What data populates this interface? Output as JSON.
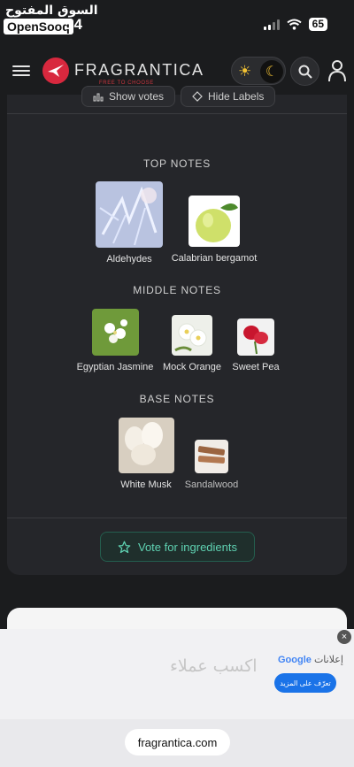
{
  "status_bar": {
    "watermark_arabic": "السوق المفتوح",
    "watermark_latin": "OpenSooq",
    "time": "14",
    "battery": "65"
  },
  "header": {
    "brand": "FRAGRANTICA",
    "tagline": "FREE TO CHOOSE"
  },
  "controls": {
    "show_votes": "Show votes",
    "hide_labels": "Hide Labels"
  },
  "sections": [
    {
      "title": "TOP NOTES",
      "notes": [
        "Aldehydes",
        "Calabrian bergamot"
      ]
    },
    {
      "title": "MIDDLE NOTES",
      "notes": [
        "Egyptian Jasmine",
        "Mock Orange",
        "Sweet Pea"
      ]
    },
    {
      "title": "BASE NOTES",
      "notes": [
        "White Musk",
        "Sandalwood"
      ]
    }
  ],
  "vote_button": "Vote for ingredients",
  "ad": {
    "headline": "اكسب عملاء",
    "label_brand": "Google",
    "label_text": "إعلانات",
    "cta": "تعرّف على المزيد",
    "close": "×"
  },
  "browser": {
    "url": "fragrantica.com"
  },
  "colors": {
    "accent": "#5fd2b2",
    "brand_red": "#d8283e",
    "background": "#1b1c1e",
    "card": "#25262a"
  }
}
